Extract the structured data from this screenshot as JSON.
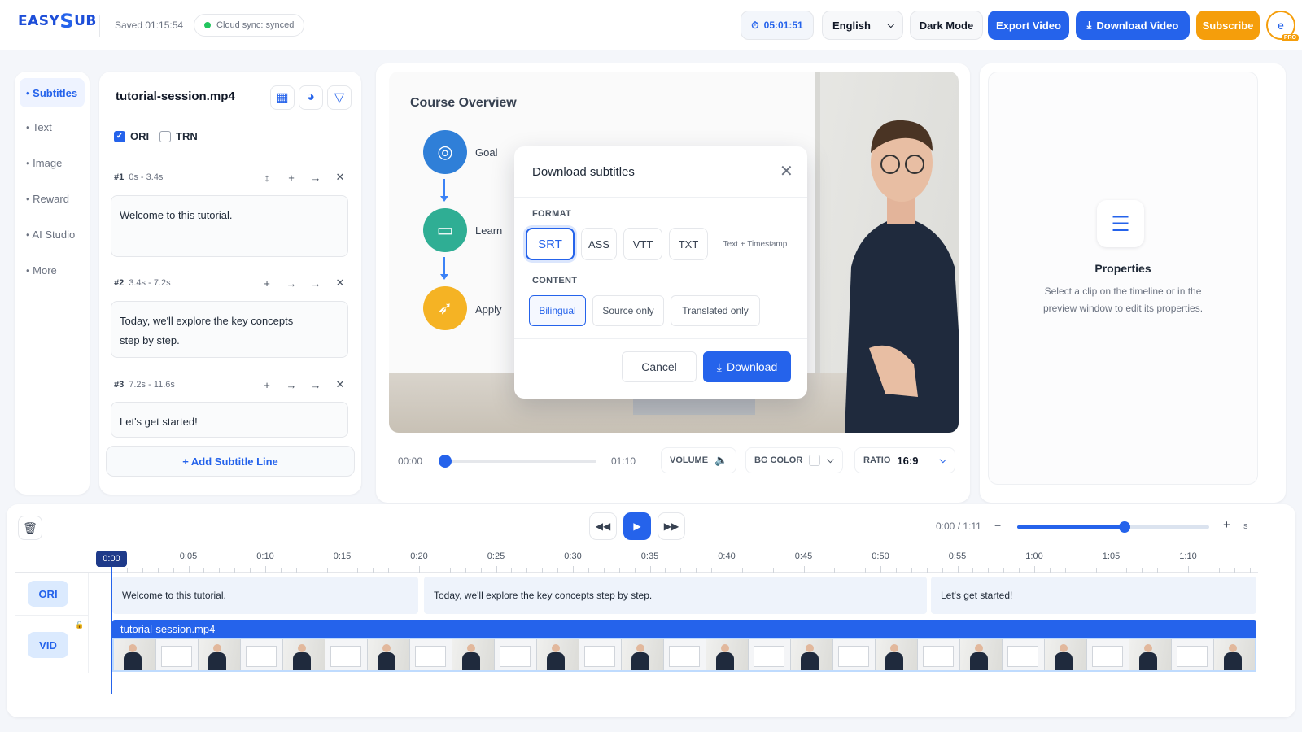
{
  "header": {
    "logo": "EASYSUB",
    "logo_pre": "EASY",
    "logo_s": "S",
    "logo_post": "UB",
    "saved": "Saved 01:15:54",
    "sync": "Cloud sync: synced",
    "timer": "05:01:51",
    "language": "English",
    "dark_mode": "Dark Mode",
    "export": "Export Video",
    "download_video": "Download Video",
    "subscribe": "Subscribe",
    "avatar_letter": "e",
    "pro_badge": "PRO"
  },
  "nav": {
    "items": [
      {
        "label": "• Subtitles",
        "active": true
      },
      {
        "label": "• Text"
      },
      {
        "label": "• Image"
      },
      {
        "label": "• Reward"
      },
      {
        "label": "• AI Studio"
      },
      {
        "label": "• More"
      }
    ]
  },
  "subtitles": {
    "file": "tutorial-session.mp4",
    "ori": "ORI",
    "trn": "TRN",
    "ori_checked": true,
    "trn_checked": false,
    "lines": [
      {
        "num": "#1",
        "time": "0s - 3.4s",
        "text": "Welcome to this tutorial."
      },
      {
        "num": "#2",
        "time": "3.4s - 7.2s",
        "text": "Today, we'll explore the key concepts step by step."
      },
      {
        "num": "#3",
        "time": "7.2s - 11.6s",
        "text": "Let's get started!"
      }
    ],
    "add_line": "+ Add Subtitle Line"
  },
  "preview": {
    "slide_title": "Course  Overview",
    "steps": [
      {
        "label": "Goal",
        "icon": "target-icon",
        "color": "#2f7fd8"
      },
      {
        "label": "Learn",
        "icon": "book-icon",
        "color": "#2fae94"
      },
      {
        "label": "Apply",
        "icon": "rocket-icon",
        "color": "#f5b324"
      }
    ],
    "time_start": "00:00",
    "time_end": "01:10",
    "progress": 0,
    "volume_label": "VOLUME",
    "bg_color_label": "BG COLOR",
    "ratio_label": "RATIO",
    "ratio": "16:9"
  },
  "dialog": {
    "title": "Download subtitles",
    "format_label": "FORMAT",
    "formats": [
      "SRT",
      "ASS",
      "VTT",
      "TXT",
      "Text + Timestamp"
    ],
    "selected_format": "SRT",
    "content_label": "CONTENT",
    "contents": [
      "Bilingual",
      "Source only",
      "Translated only"
    ],
    "selected_content": "Bilingual",
    "cancel": "Cancel",
    "download": "Download"
  },
  "properties": {
    "title": "Properties",
    "description": "Select a clip on the timeline or in the preview window to edit its properties."
  },
  "timeline": {
    "time": "0:00 / 1:11",
    "zoom_level": 0.56,
    "zoom_unit": "s",
    "zoom_minus": "−",
    "zoom_plus": "+",
    "playhead": "0:00",
    "ticks": [
      "0:05",
      "0:10",
      "0:15",
      "0:20",
      "0:25",
      "0:30",
      "0:35",
      "0:40",
      "0:45",
      "0:50",
      "0:55",
      "1:00",
      "1:05",
      "1:10"
    ],
    "tracks": {
      "ori": "ORI",
      "vid": "VID"
    },
    "segments": [
      "Welcome to this tutorial.",
      "Today, we'll explore the key concepts step by step.",
      "Let's get started!"
    ],
    "video_clip": "tutorial-session.mp4"
  },
  "colors": {
    "accent": "#2563eb",
    "subscribe": "#f59e0b",
    "sync": "#22c55e"
  }
}
